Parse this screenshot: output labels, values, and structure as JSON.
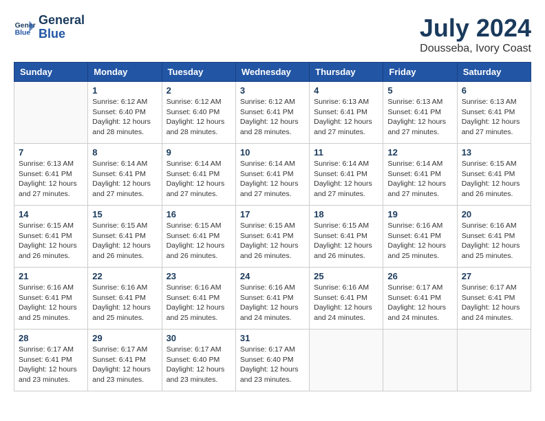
{
  "header": {
    "logo_line1": "General",
    "logo_line2": "Blue",
    "month_year": "July 2024",
    "location": "Dousseba, Ivory Coast"
  },
  "weekdays": [
    "Sunday",
    "Monday",
    "Tuesday",
    "Wednesday",
    "Thursday",
    "Friday",
    "Saturday"
  ],
  "weeks": [
    [
      {
        "day": "",
        "empty": true
      },
      {
        "day": "1",
        "sunrise": "6:12 AM",
        "sunset": "6:40 PM",
        "daylight": "12 hours and 28 minutes."
      },
      {
        "day": "2",
        "sunrise": "6:12 AM",
        "sunset": "6:40 PM",
        "daylight": "12 hours and 28 minutes."
      },
      {
        "day": "3",
        "sunrise": "6:12 AM",
        "sunset": "6:41 PM",
        "daylight": "12 hours and 28 minutes."
      },
      {
        "day": "4",
        "sunrise": "6:13 AM",
        "sunset": "6:41 PM",
        "daylight": "12 hours and 27 minutes."
      },
      {
        "day": "5",
        "sunrise": "6:13 AM",
        "sunset": "6:41 PM",
        "daylight": "12 hours and 27 minutes."
      },
      {
        "day": "6",
        "sunrise": "6:13 AM",
        "sunset": "6:41 PM",
        "daylight": "12 hours and 27 minutes."
      }
    ],
    [
      {
        "day": "7",
        "sunrise": "6:13 AM",
        "sunset": "6:41 PM",
        "daylight": "12 hours and 27 minutes."
      },
      {
        "day": "8",
        "sunrise": "6:14 AM",
        "sunset": "6:41 PM",
        "daylight": "12 hours and 27 minutes."
      },
      {
        "day": "9",
        "sunrise": "6:14 AM",
        "sunset": "6:41 PM",
        "daylight": "12 hours and 27 minutes."
      },
      {
        "day": "10",
        "sunrise": "6:14 AM",
        "sunset": "6:41 PM",
        "daylight": "12 hours and 27 minutes."
      },
      {
        "day": "11",
        "sunrise": "6:14 AM",
        "sunset": "6:41 PM",
        "daylight": "12 hours and 27 minutes."
      },
      {
        "day": "12",
        "sunrise": "6:14 AM",
        "sunset": "6:41 PM",
        "daylight": "12 hours and 27 minutes."
      },
      {
        "day": "13",
        "sunrise": "6:15 AM",
        "sunset": "6:41 PM",
        "daylight": "12 hours and 26 minutes."
      }
    ],
    [
      {
        "day": "14",
        "sunrise": "6:15 AM",
        "sunset": "6:41 PM",
        "daylight": "12 hours and 26 minutes."
      },
      {
        "day": "15",
        "sunrise": "6:15 AM",
        "sunset": "6:41 PM",
        "daylight": "12 hours and 26 minutes."
      },
      {
        "day": "16",
        "sunrise": "6:15 AM",
        "sunset": "6:41 PM",
        "daylight": "12 hours and 26 minutes."
      },
      {
        "day": "17",
        "sunrise": "6:15 AM",
        "sunset": "6:41 PM",
        "daylight": "12 hours and 26 minutes."
      },
      {
        "day": "18",
        "sunrise": "6:15 AM",
        "sunset": "6:41 PM",
        "daylight": "12 hours and 26 minutes."
      },
      {
        "day": "19",
        "sunrise": "6:16 AM",
        "sunset": "6:41 PM",
        "daylight": "12 hours and 25 minutes."
      },
      {
        "day": "20",
        "sunrise": "6:16 AM",
        "sunset": "6:41 PM",
        "daylight": "12 hours and 25 minutes."
      }
    ],
    [
      {
        "day": "21",
        "sunrise": "6:16 AM",
        "sunset": "6:41 PM",
        "daylight": "12 hours and 25 minutes."
      },
      {
        "day": "22",
        "sunrise": "6:16 AM",
        "sunset": "6:41 PM",
        "daylight": "12 hours and 25 minutes."
      },
      {
        "day": "23",
        "sunrise": "6:16 AM",
        "sunset": "6:41 PM",
        "daylight": "12 hours and 25 minutes."
      },
      {
        "day": "24",
        "sunrise": "6:16 AM",
        "sunset": "6:41 PM",
        "daylight": "12 hours and 24 minutes."
      },
      {
        "day": "25",
        "sunrise": "6:16 AM",
        "sunset": "6:41 PM",
        "daylight": "12 hours and 24 minutes."
      },
      {
        "day": "26",
        "sunrise": "6:17 AM",
        "sunset": "6:41 PM",
        "daylight": "12 hours and 24 minutes."
      },
      {
        "day": "27",
        "sunrise": "6:17 AM",
        "sunset": "6:41 PM",
        "daylight": "12 hours and 24 minutes."
      }
    ],
    [
      {
        "day": "28",
        "sunrise": "6:17 AM",
        "sunset": "6:41 PM",
        "daylight": "12 hours and 23 minutes."
      },
      {
        "day": "29",
        "sunrise": "6:17 AM",
        "sunset": "6:41 PM",
        "daylight": "12 hours and 23 minutes."
      },
      {
        "day": "30",
        "sunrise": "6:17 AM",
        "sunset": "6:40 PM",
        "daylight": "12 hours and 23 minutes."
      },
      {
        "day": "31",
        "sunrise": "6:17 AM",
        "sunset": "6:40 PM",
        "daylight": "12 hours and 23 minutes."
      },
      {
        "day": "",
        "empty": true
      },
      {
        "day": "",
        "empty": true
      },
      {
        "day": "",
        "empty": true
      }
    ]
  ],
  "labels": {
    "sunrise_prefix": "Sunrise: ",
    "sunset_prefix": "Sunset: ",
    "daylight_prefix": "Daylight: "
  }
}
